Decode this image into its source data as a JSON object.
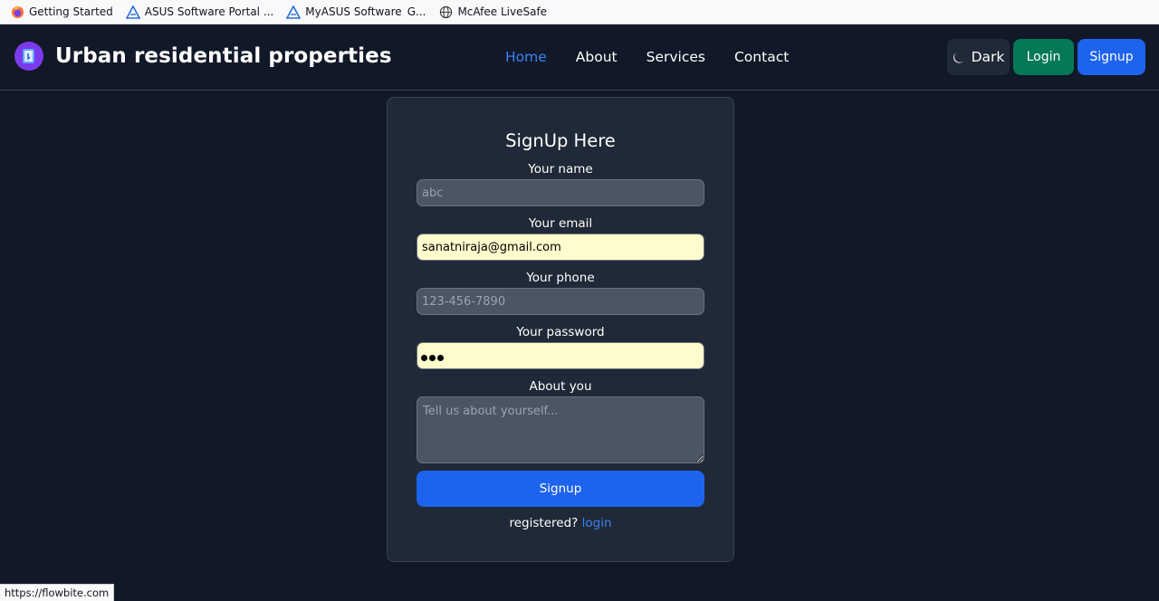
{
  "bookmarks": [
    {
      "label": "Getting Started",
      "icon": "firefox-icon"
    },
    {
      "label": "ASUS Software Portal ...",
      "icon": "asus-icon"
    },
    {
      "label": "MyASUS Software",
      "extra": "G...",
      "icon": "asus-icon"
    },
    {
      "label": "McAfee LiveSafe",
      "icon": "globe-icon"
    }
  ],
  "navbar": {
    "brand": "Urban residential properties",
    "links": [
      "Home",
      "About",
      "Services",
      "Contact"
    ],
    "active_link": "Home",
    "theme_label": "Dark",
    "login_label": "Login",
    "signup_label": "Signup"
  },
  "form": {
    "title": "SignUp Here",
    "name_label": "Your name",
    "name_placeholder": "abc",
    "email_label": "Your email",
    "email_value": "sanatniraja@gmail.com",
    "phone_label": "Your phone",
    "phone_placeholder": "123-456-7890",
    "password_label": "Your password",
    "about_label": "About you",
    "about_placeholder": "Tell us about yourself...",
    "submit_label": "Signup",
    "registered_text": "registered?",
    "login_link": "login"
  },
  "status_url": "https://flowbite.com",
  "colors": {
    "background": "#111827",
    "card": "#1f2937",
    "primary": "#1d63ed",
    "success": "#047857",
    "link": "#3b82f6",
    "autofill": "#fefbcc"
  }
}
